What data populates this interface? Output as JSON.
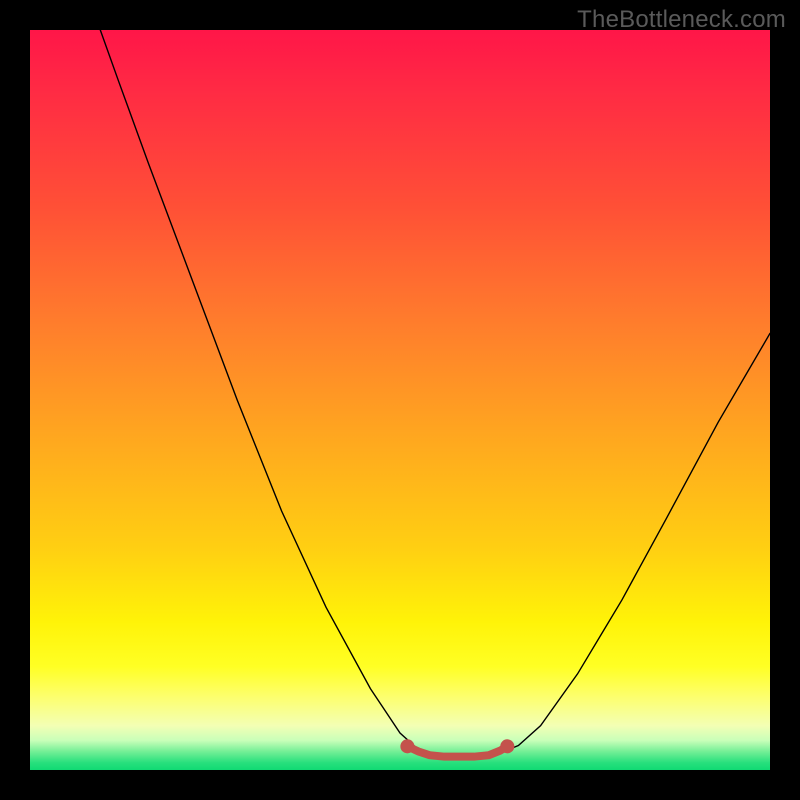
{
  "watermark": "TheBottleneck.com",
  "chart_data": {
    "type": "line",
    "title": "",
    "xlabel": "",
    "ylabel": "",
    "xlim": [
      0,
      100
    ],
    "ylim": [
      0,
      100
    ],
    "series": [
      {
        "name": "curve",
        "points": [
          {
            "x": 9.5,
            "y": 100
          },
          {
            "x": 12,
            "y": 93
          },
          {
            "x": 16,
            "y": 82
          },
          {
            "x": 22,
            "y": 66
          },
          {
            "x": 28,
            "y": 50
          },
          {
            "x": 34,
            "y": 35
          },
          {
            "x": 40,
            "y": 22
          },
          {
            "x": 46,
            "y": 11
          },
          {
            "x": 50,
            "y": 5
          },
          {
            "x": 53,
            "y": 2.3
          },
          {
            "x": 56,
            "y": 1.6
          },
          {
            "x": 60,
            "y": 1.6
          },
          {
            "x": 63,
            "y": 2.1
          },
          {
            "x": 66,
            "y": 3.3
          },
          {
            "x": 69,
            "y": 6
          },
          {
            "x": 74,
            "y": 13
          },
          {
            "x": 80,
            "y": 23
          },
          {
            "x": 86,
            "y": 34
          },
          {
            "x": 93,
            "y": 47
          },
          {
            "x": 100,
            "y": 59
          }
        ]
      },
      {
        "name": "bottom-marker",
        "points": [
          {
            "x": 51,
            "y": 3.2
          },
          {
            "x": 52.5,
            "y": 2.5
          },
          {
            "x": 54,
            "y": 2.0
          },
          {
            "x": 56,
            "y": 1.8
          },
          {
            "x": 58,
            "y": 1.8
          },
          {
            "x": 60,
            "y": 1.8
          },
          {
            "x": 62,
            "y": 2.0
          },
          {
            "x": 63.5,
            "y": 2.6
          },
          {
            "x": 64.5,
            "y": 3.2
          }
        ]
      }
    ],
    "colors": {
      "curve": "#000000",
      "bottom_marker_stroke": "#c4524c",
      "bottom_marker_dot": "#c4524c"
    }
  }
}
